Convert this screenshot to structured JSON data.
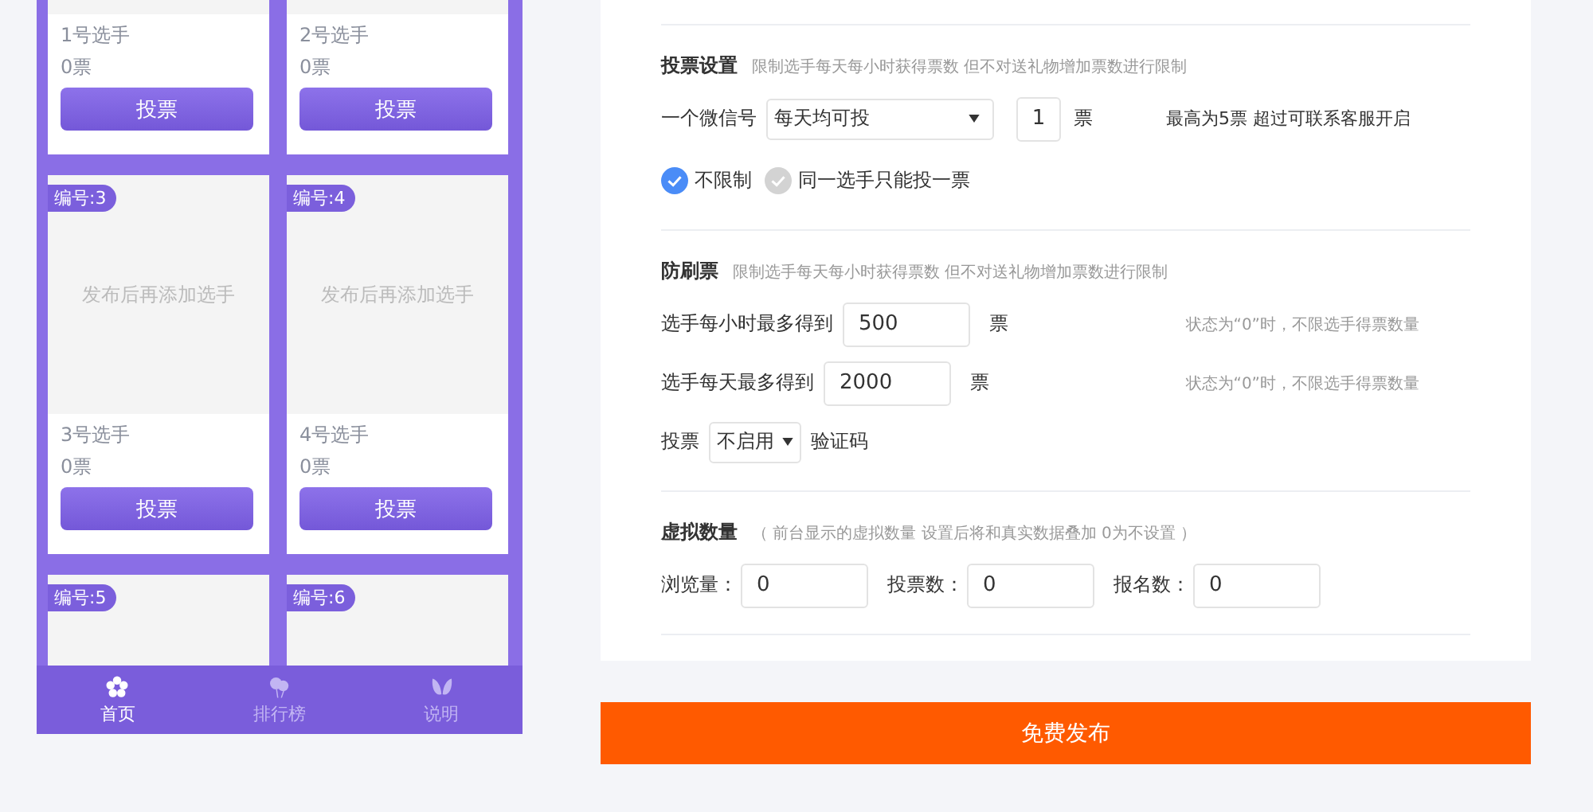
{
  "preview": {
    "cards": [
      {
        "name": "1号选手",
        "votes": "0票",
        "button": "投票"
      },
      {
        "name": "2号选手",
        "votes": "0票",
        "button": "投票"
      },
      {
        "badge": "编号:3",
        "placeholder": "发布后再添加选手",
        "name": "3号选手",
        "votes": "0票",
        "button": "投票"
      },
      {
        "badge": "编号:4",
        "placeholder": "发布后再添加选手",
        "name": "4号选手",
        "votes": "0票",
        "button": "投票"
      },
      {
        "badge": "编号:5"
      },
      {
        "badge": "编号:6"
      }
    ],
    "nav": [
      {
        "label": "首页",
        "kind": "flower",
        "selected": true
      },
      {
        "label": "排行榜",
        "kind": "balloon",
        "selected": false
      },
      {
        "label": "说明",
        "kind": "butterfly",
        "selected": false
      }
    ]
  },
  "vote_settings": {
    "title": "投票设置",
    "hint": "限制选手每天每小时获得票数 但不对送礼物增加票数进行限制",
    "label": "一个微信号",
    "mode": "每天均可投",
    "count": "1",
    "unit": "票",
    "note": "最高为5票 超过可联系客服开启",
    "options": [
      {
        "label": "不限制",
        "selected": true
      },
      {
        "label": "同一选手只能投一票",
        "selected": false
      }
    ]
  },
  "anti_fraud": {
    "title": "防刷票",
    "hint": "限制选手每天每小时获得票数 但不对送礼物增加票数进行限制",
    "limits": [
      {
        "label": "选手每小时最多得到",
        "value": "500",
        "unit": "票",
        "note": "状态为“0”时，不限选手得票数量"
      },
      {
        "label": "选手每天最多得到",
        "value": "2000",
        "unit": "票",
        "note": "状态为“0”时，不限选手得票数量"
      }
    ],
    "captcha": {
      "label": "投票",
      "value": "不启用",
      "suffix": "验证码"
    }
  },
  "virtual_counts": {
    "title": "虚拟数量",
    "hint": "（ 前台显示的虚拟数量 设置后将和真实数据叠加 0为不设置 ）",
    "fields": [
      {
        "label": "浏览量：",
        "value": "0"
      },
      {
        "label": "投票数：",
        "value": "0"
      },
      {
        "label": "报名数：",
        "value": "0"
      }
    ]
  },
  "publish_button": "免费发布"
}
